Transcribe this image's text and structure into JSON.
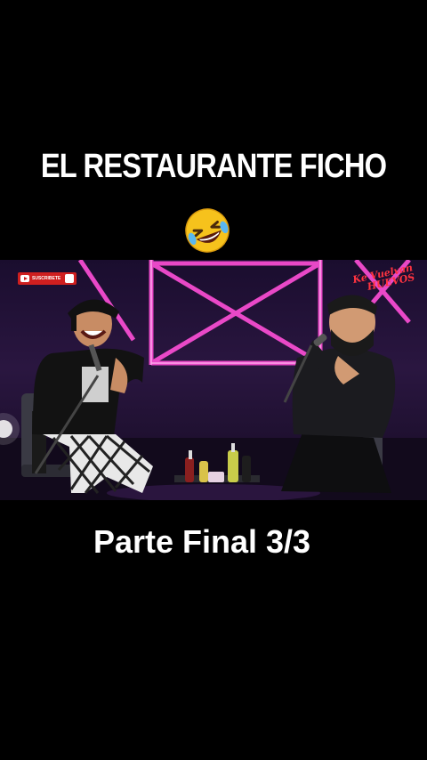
{
  "overlay": {
    "title": "EL RESTAURANTE FICHO",
    "emoji": "rolling-on-floor-laughing",
    "part_label": "Parte Final 3/3"
  },
  "video": {
    "subscribe_label": "SUSCRIBETE",
    "channel_logo_line1": "Ke Vuelvan",
    "channel_logo_line2": "HUEVOS"
  },
  "colors": {
    "background": "#000000",
    "text": "#ffffff",
    "neon_pink": "#ff4fd8",
    "stage_purple": "#2a1640",
    "subscribe_red": "#cf1f1f"
  }
}
